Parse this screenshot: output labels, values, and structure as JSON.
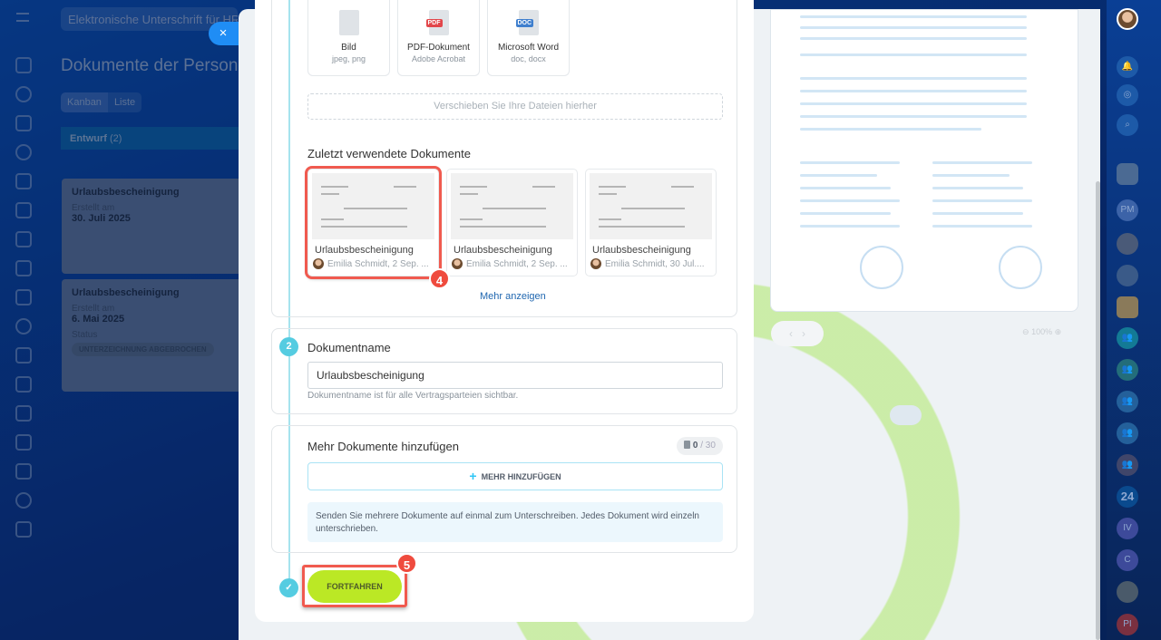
{
  "header": {
    "search": "Elektronische Unterschrift für HR"
  },
  "page": {
    "title": "Dokumente der Personalabteilung",
    "tabs": [
      "Kanban",
      "Liste"
    ]
  },
  "kanban": {
    "column": "Entwurf",
    "count": "(2)",
    "cards": [
      {
        "title": "Urlaubsbescheinigung",
        "created_label": "Erstellt am",
        "date": "30. Juli 2025"
      },
      {
        "title": "Urlaubsbescheinigung",
        "created_label": "Erstellt am",
        "date": "6. Mai 2025",
        "status_label": "Status",
        "status": "UNTERZEICHNUNG ABGEBROCHEN"
      }
    ]
  },
  "close": "×",
  "upload": {
    "types": [
      {
        "name": "Bild",
        "sub": "jpeg, png",
        "tag": ""
      },
      {
        "name": "PDF-Dokument",
        "sub": "Adobe Acrobat",
        "tag": "PDF"
      },
      {
        "name": "Microsoft Word",
        "sub": "doc, docx",
        "tag": "DOC"
      }
    ],
    "drop": "Verschieben Sie Ihre Dateien hierher"
  },
  "recent": {
    "title": "Zuletzt verwendete Dokumente",
    "docs": [
      {
        "name": "Urlaubsbescheinigung",
        "by": "Emilia Schmidt, 2 Sep. ..."
      },
      {
        "name": "Urlaubsbescheinigung",
        "by": "Emilia Schmidt, 2 Sep. ..."
      },
      {
        "name": "Urlaubsbescheinigung",
        "by": "Emilia Schmidt, 30 Jul...."
      }
    ],
    "more": "Mehr anzeigen"
  },
  "step2": {
    "num": "2",
    "title": "Dokumentname",
    "value": "Urlaubsbescheinigung",
    "hint": "Dokumentname ist für alle Vertragsparteien sichtbar."
  },
  "step3": {
    "title": "Mehr Dokumente hinzufügen",
    "count": "0",
    "max": "/ 30",
    "button": "MEHR HINZUFÜGEN",
    "info": "Senden Sie mehrere Dokumente auf einmal zum Unterschreiben. Jedes Dokument wird einzeln unterschrieben."
  },
  "continue": "FORTFAHREN",
  "annotations": [
    "4",
    "5"
  ],
  "preview": {
    "zoom": "100%"
  },
  "rsidebar": {
    "items": [
      "PM",
      "24",
      "IV",
      "C",
      "PI"
    ]
  }
}
